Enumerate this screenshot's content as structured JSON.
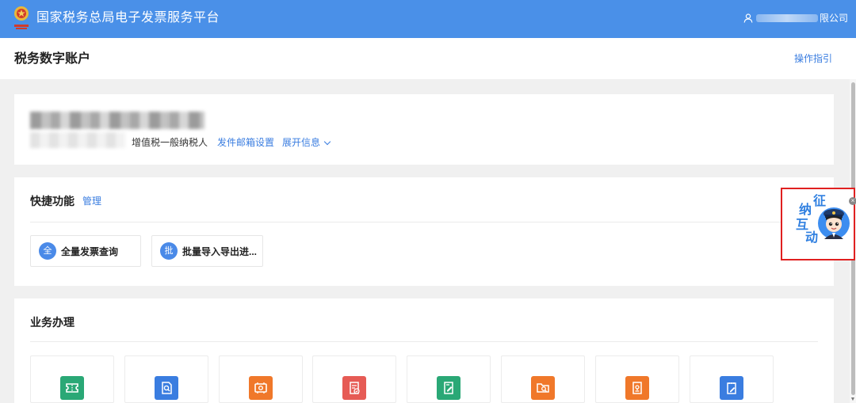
{
  "header": {
    "platform_title": "国家税务总局电子发票服务平台",
    "user_company_suffix": "限公司"
  },
  "subheader": {
    "page_title": "税务数字账户",
    "guide_link": "操作指引"
  },
  "info": {
    "taxpayer_type": "增值税一般纳税人",
    "mail_settings": "发件邮箱设置",
    "expand_info": "展开信息"
  },
  "quick": {
    "title": "快捷功能",
    "manage": "管理",
    "items": [
      {
        "badge": "全",
        "label": "全量发票查询"
      },
      {
        "badge": "批",
        "label": "批量导入导出进..."
      }
    ]
  },
  "business": {
    "title": "业务办理",
    "tiles": [
      {
        "icon": "ticket-icon",
        "color": "#2aa876"
      },
      {
        "icon": "document-search-icon",
        "color": "#3a7de0"
      },
      {
        "icon": "invoice-icon",
        "color": "#f0782a"
      },
      {
        "icon": "document-check-icon",
        "color": "#e65b55"
      },
      {
        "icon": "document-edit-icon",
        "color": "#2aa876"
      },
      {
        "icon": "folder-search-icon",
        "color": "#f0782a"
      },
      {
        "icon": "document-stamp-icon",
        "color": "#f0782a"
      },
      {
        "icon": "notepad-edit-icon",
        "color": "#3a7de0"
      }
    ]
  },
  "float_widget": {
    "chars": [
      "征",
      "纳",
      "互",
      "动"
    ],
    "close": "×",
    "icon": "tax-officer-avatar-icon"
  },
  "colors": {
    "topbar": "#4a90e8",
    "link": "#3a7de0",
    "highlight_border": "#e02020"
  }
}
